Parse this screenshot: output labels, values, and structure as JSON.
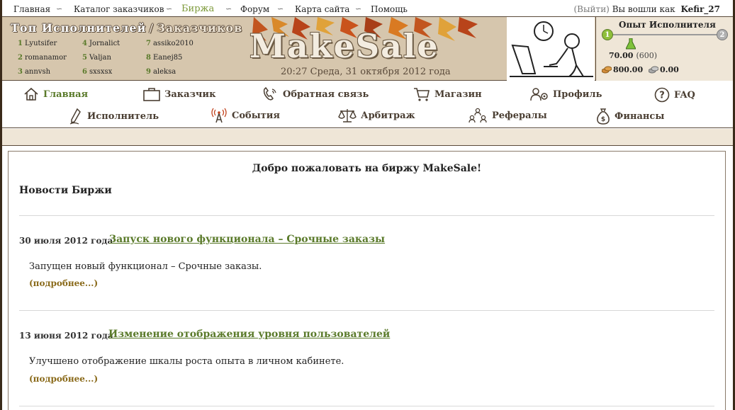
{
  "topnav": {
    "items": [
      "Главная",
      "Каталог заказчиков",
      "Биржа",
      "Форум",
      "Карта сайта",
      "Помощь"
    ],
    "active_index": 2,
    "exit_label": "(Выйти)",
    "logged_in_label": "Вы вошли как",
    "username": "Kefir_27"
  },
  "header": {
    "top_title_performers": "Топ Исполнителей",
    "top_title_slash": "/",
    "top_title_customers": "Заказчиков",
    "top": [
      {
        "rank": "1",
        "name": "Lyutsifer"
      },
      {
        "rank": "2",
        "name": "romanamor"
      },
      {
        "rank": "3",
        "name": "annvsh"
      },
      {
        "rank": "4",
        "name": "Jornalict"
      },
      {
        "rank": "5",
        "name": "Valjan"
      },
      {
        "rank": "6",
        "name": "sxsxsx"
      },
      {
        "rank": "7",
        "name": "assiko2010"
      },
      {
        "rank": "8",
        "name": "Eanej85"
      },
      {
        "rank": "9",
        "name": "aleksa"
      }
    ],
    "logo": "MakeSale",
    "datetime": "20:27 Среда, 31 октября 2012 года"
  },
  "experience": {
    "title": "Опыт Исполнителя",
    "level_from": "1",
    "level_to": "2",
    "current": "70.00",
    "max": "(600)",
    "money_gold": "800.00",
    "money_silver": "0.00",
    "progress_fraction": 0.1167
  },
  "menu": {
    "row1": [
      {
        "label": "Главная",
        "icon": "home-icon"
      },
      {
        "label": "Заказчик",
        "icon": "briefcase-icon"
      },
      {
        "label": "Обратная связь",
        "icon": "phone-icon"
      },
      {
        "label": "Магазин",
        "icon": "cart-icon"
      },
      {
        "label": "Профиль",
        "icon": "profile-gear-icon"
      },
      {
        "label": "FAQ",
        "icon": "question-icon"
      }
    ],
    "row2": [
      {
        "label": "Исполнитель",
        "icon": "pencil-icon"
      },
      {
        "label": "События",
        "icon": "antenna-icon"
      },
      {
        "label": "Арбитраж",
        "icon": "scales-icon"
      },
      {
        "label": "Рефералы",
        "icon": "referrals-icon"
      },
      {
        "label": "Финансы",
        "icon": "money-bag-icon"
      }
    ],
    "active": "Главная"
  },
  "content": {
    "welcome": "Добро пожаловать на биржу MakeSale!",
    "news_heading": "Новости Биржи",
    "news": [
      {
        "date": "30 июля 2012 года",
        "title": "Запуск нового функционала – Срочные заказы",
        "body": "Запущен новый функционал – Срочные заказы.",
        "more": "(подробнее...)"
      },
      {
        "date": "13 июня 2012 года",
        "title": "Изменение отображения уровня пользователей",
        "body": "Улучшено отображение шкалы роста опыта в личном кабинете.",
        "more": "(подробнее...)"
      }
    ]
  },
  "colors": {
    "header_bg": "#d6c6ad",
    "accent_green": "#5a7a2a",
    "more_link": "#8a6a1a",
    "strip_bg": "#efe6d7"
  }
}
